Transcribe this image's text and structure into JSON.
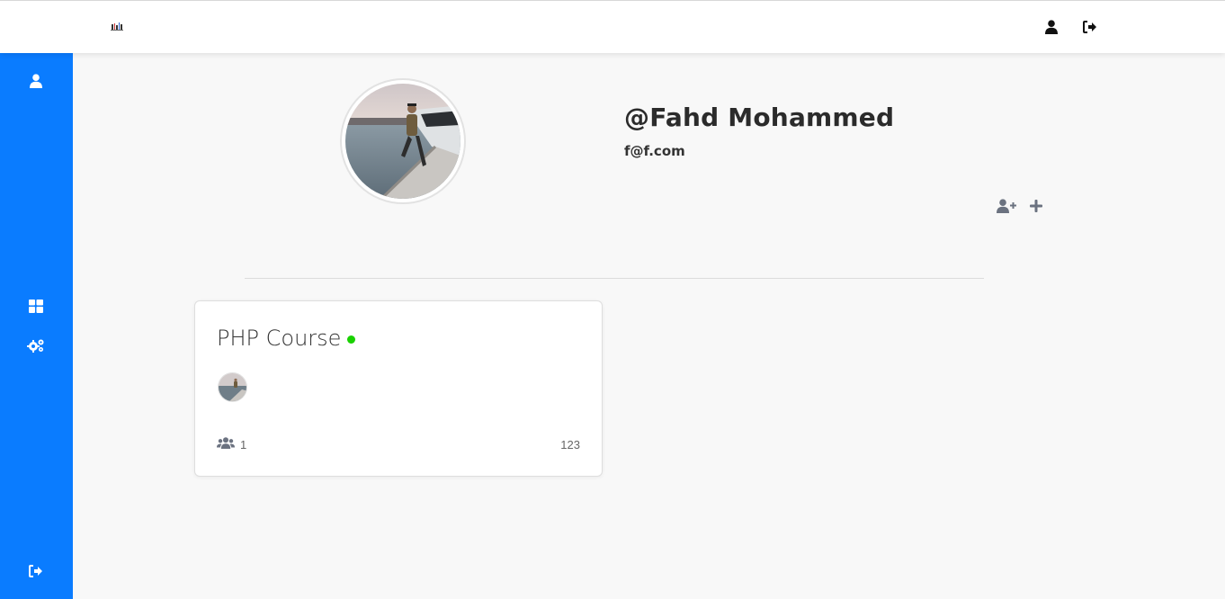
{
  "header": {
    "logo_icon": "logo-mark",
    "icons": [
      "user-icon",
      "sign-out-icon"
    ]
  },
  "sidebar": {
    "items": [
      {
        "icon": "user-icon"
      },
      {
        "icon": "grid-icon"
      },
      {
        "icon": "cogs-icon"
      },
      {
        "icon": "sign-out-icon"
      }
    ],
    "color": "#0a7cff"
  },
  "profile": {
    "username": "@Fahd Mohammed",
    "email": "f@f.com",
    "actions": [
      "add-user-icon",
      "plus-icon"
    ]
  },
  "course_card": {
    "title": "PHP Course",
    "status_color": "#19d100",
    "member_count": "1",
    "code": "123"
  }
}
